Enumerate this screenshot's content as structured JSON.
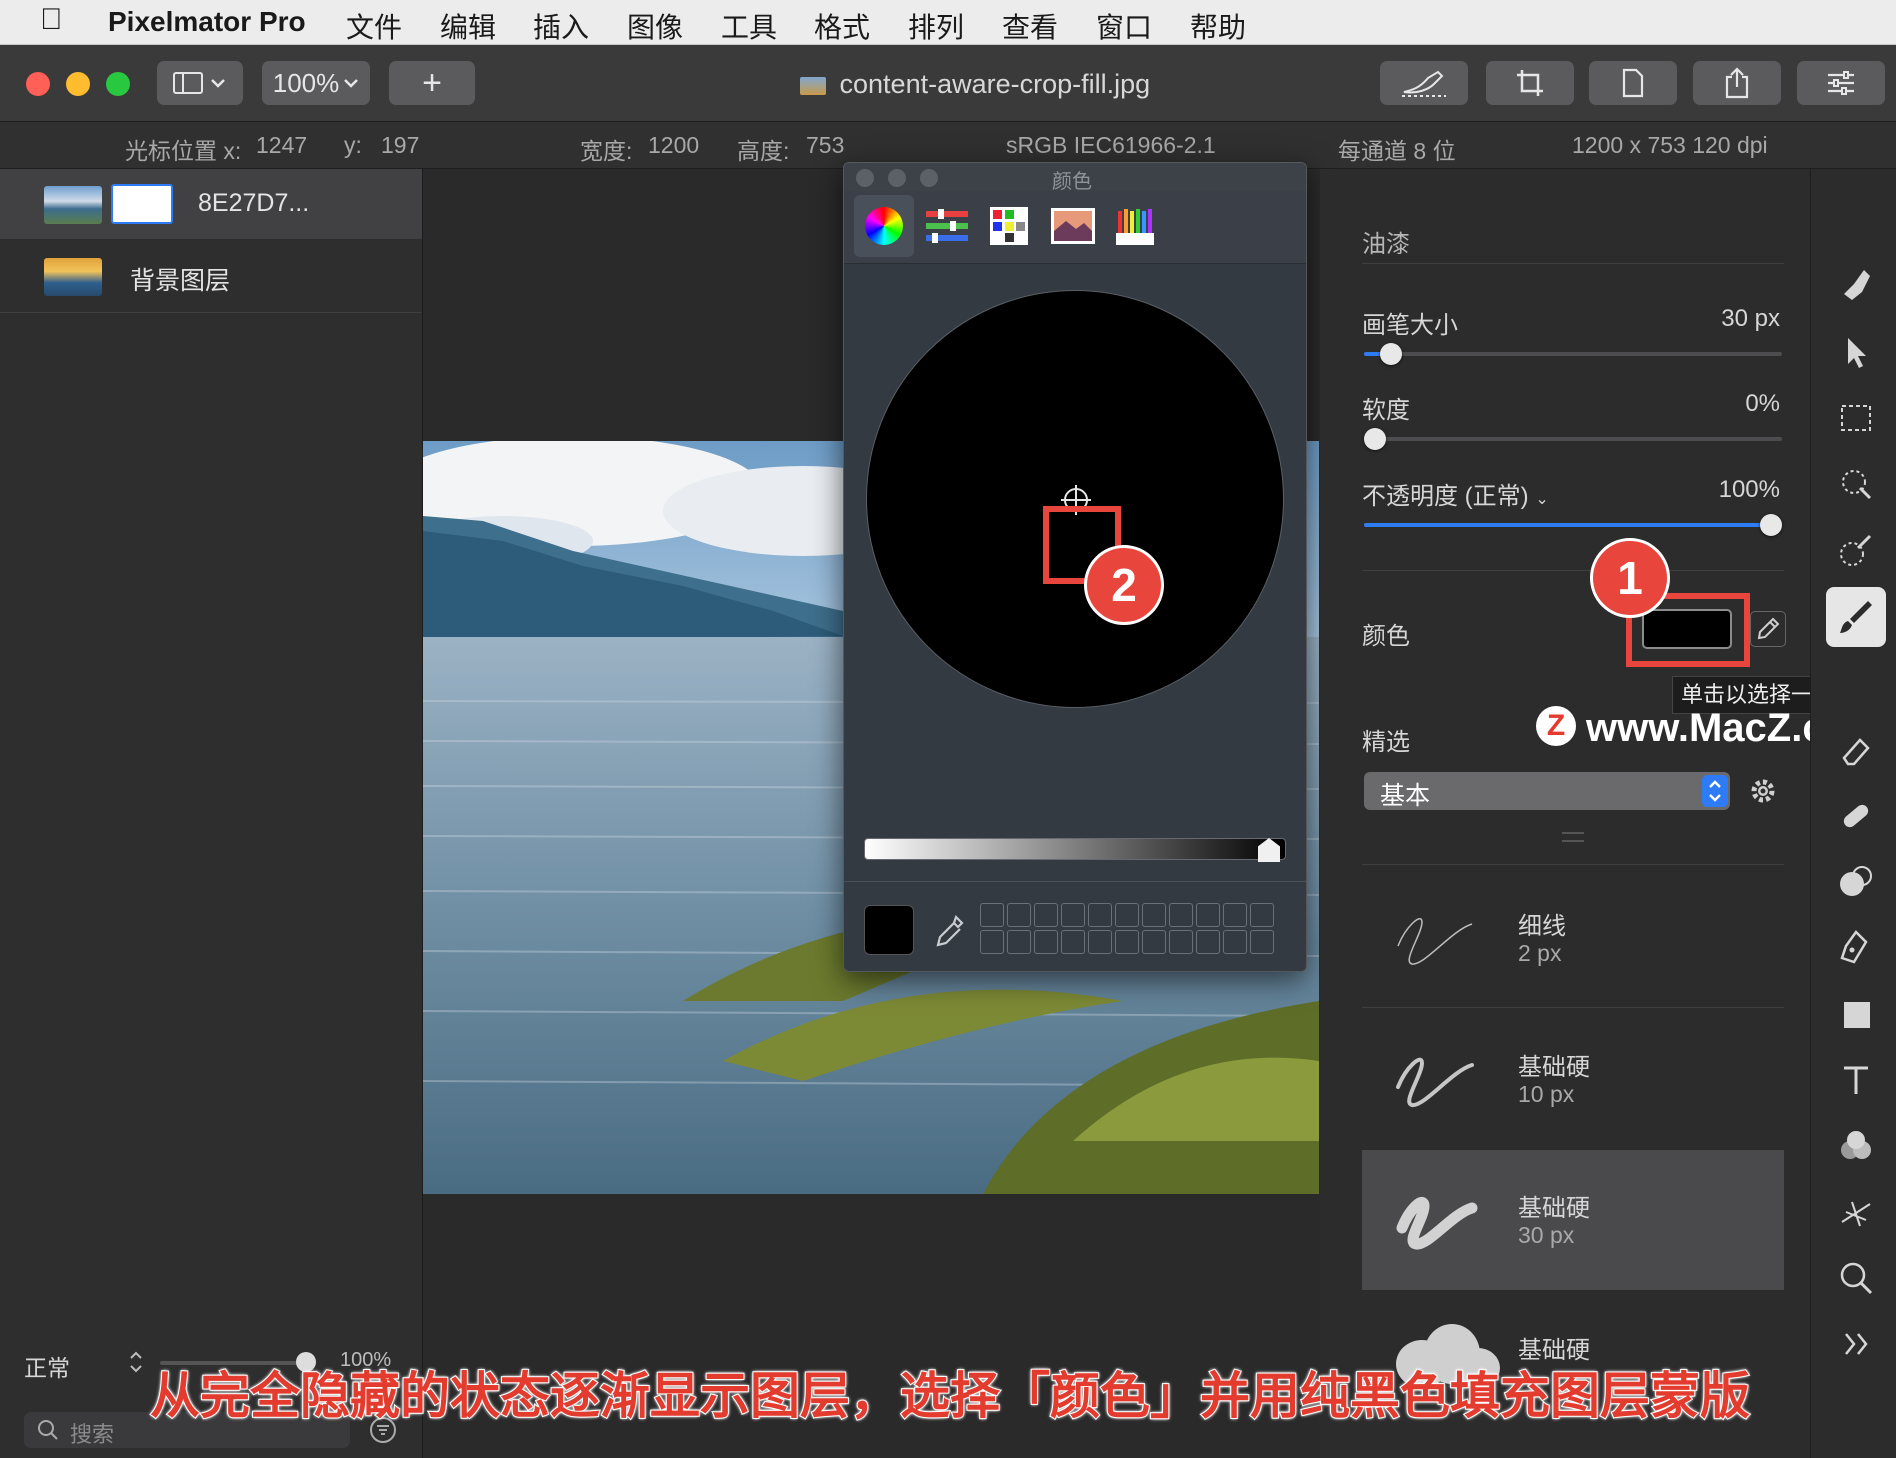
{
  "menubar": {
    "app_name": "Pixelmator Pro",
    "items": [
      "文件",
      "编辑",
      "插入",
      "图像",
      "工具",
      "格式",
      "排列",
      "查看",
      "窗口",
      "帮助"
    ]
  },
  "toolbar": {
    "zoom": "100%",
    "add_label": "+",
    "document_title": "content-aware-crop-fill.jpg"
  },
  "infobar": {
    "cursor_x_label": "光标位置 x:",
    "cursor_x": "1247",
    "cursor_y_label": "y:",
    "cursor_y": "197",
    "width_label": "宽度:",
    "width": "1200",
    "height_label": "高度:",
    "height": "753",
    "color_profile": "sRGB IEC61966-2.1",
    "bit_depth": "每通道 8 位",
    "dimensions": "1200 x 753 120 dpi"
  },
  "layers": {
    "items": [
      {
        "name": "8E27D7..."
      },
      {
        "name": "背景图层"
      }
    ],
    "blend_mode": "正常",
    "opacity": "100%",
    "search_placeholder": "搜索"
  },
  "color_panel": {
    "title": "颜色",
    "tabs": [
      "color-wheel",
      "color-sliders",
      "color-palettes",
      "image-palettes",
      "pencils"
    ]
  },
  "paint_panel": {
    "section_title": "油漆",
    "brush_size_label": "画笔大小",
    "brush_size_value": "30 px",
    "brush_size_fraction": 0.04,
    "softness_label": "软度",
    "softness_value": "0%",
    "softness_fraction": 0.0,
    "opacity_label": "不透明度 (正常)",
    "opacity_value": "100%",
    "opacity_fraction": 1.0,
    "color_label": "颜色",
    "color_value": "#000000",
    "tooltip": "单击以选择一种颜色。",
    "presets_label": "精选",
    "presets_select": "基本",
    "brushes": [
      {
        "name": "细线",
        "size": "2 px"
      },
      {
        "name": "基础硬",
        "size": "10 px"
      },
      {
        "name": "基础硬",
        "size": "30 px"
      },
      {
        "name": "基础硬",
        "size": ""
      }
    ]
  },
  "annotations": {
    "marker_1": "1",
    "marker_2": "2",
    "watermark": "www.MacZ.com",
    "caption": "从完全隐藏的状态逐渐显示图层，选择「颜色」并用纯黑色填充图层蒙版"
  },
  "colors": {
    "accent": "#2e7bf6",
    "annotation_red": "#e8453c"
  }
}
